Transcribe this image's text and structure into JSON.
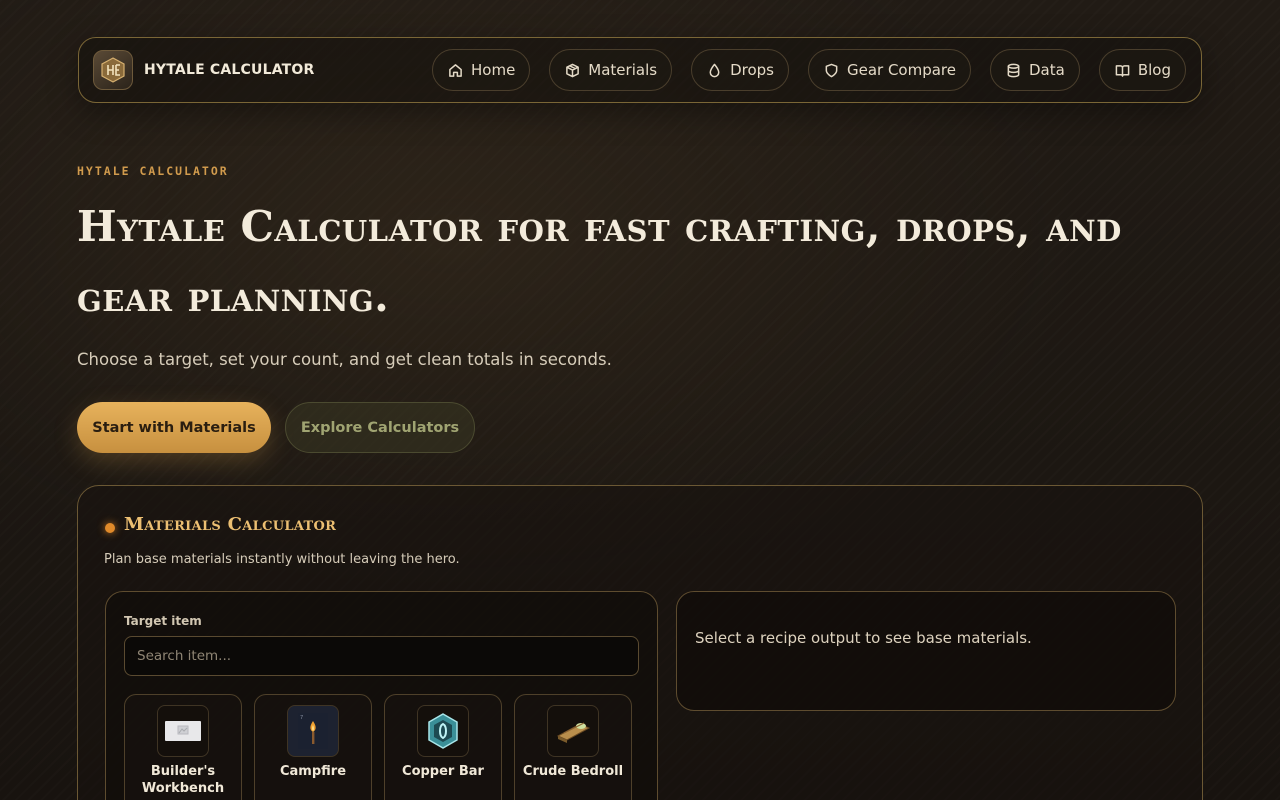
{
  "brand": {
    "name": "HYTALE CALCULATOR"
  },
  "nav": {
    "items": [
      {
        "label": "Home",
        "icon": "home-icon"
      },
      {
        "label": "Materials",
        "icon": "box-icon"
      },
      {
        "label": "Drops",
        "icon": "drop-icon"
      },
      {
        "label": "Gear Compare",
        "icon": "shield-icon"
      },
      {
        "label": "Data",
        "icon": "database-icon"
      },
      {
        "label": "Blog",
        "icon": "book-icon"
      }
    ]
  },
  "hero": {
    "eyebrow": "HYTALE CALCULATOR",
    "title": "Hytale Calculator for fast crafting, drops, and gear planning.",
    "subtitle": "Choose a target, set your count, and get clean totals in seconds.",
    "primary_button": "Start with Materials",
    "secondary_button": "Explore Calculators"
  },
  "calculator": {
    "title": "Materials Calculator",
    "description": "Plan base materials instantly without leaving the hero.",
    "target_label": "Target item",
    "search_placeholder": "Search item...",
    "items": [
      {
        "name": "Builder's Workbench",
        "icon": "workbench-icon"
      },
      {
        "name": "Campfire",
        "icon": "campfire-icon"
      },
      {
        "name": "Copper Bar",
        "icon": "copper-bar-icon"
      },
      {
        "name": "Crude Bedroll",
        "icon": "bedroll-icon"
      }
    ],
    "result_placeholder": "Select a recipe output to see base materials."
  },
  "colors": {
    "accent": "#e7b25c",
    "panel_title": "#ecbf72",
    "eyebrow": "#d19b4d",
    "border": "#7a6636"
  }
}
